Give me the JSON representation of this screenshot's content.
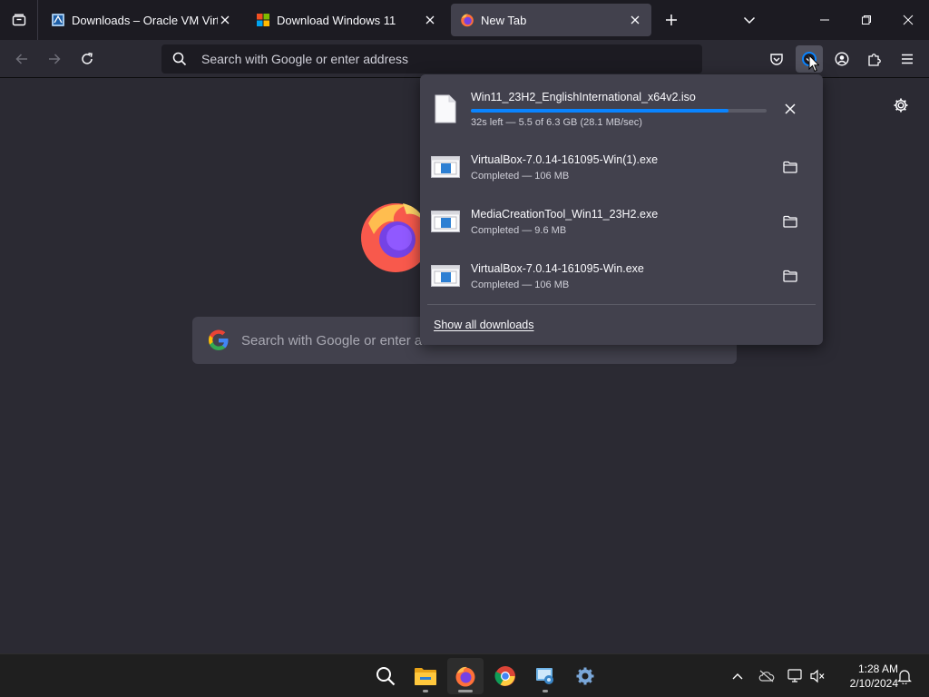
{
  "tabs": [
    {
      "title": "Downloads – Oracle VM VirtualBox",
      "favicon": "virtualbox-icon",
      "active": false
    },
    {
      "title": "Download Windows 11",
      "favicon": "windows-icon",
      "active": false
    },
    {
      "title": "New Tab",
      "favicon": "firefox-icon",
      "active": true
    }
  ],
  "urlbar": {
    "placeholder": "Search with Google or enter address"
  },
  "page": {
    "search_placeholder": "Search with Google or enter address"
  },
  "downloads": {
    "items": [
      {
        "name": "Win11_23H2_EnglishInternational_x64v2.iso",
        "status": "32s left — 5.5 of 6.3 GB (28.1 MB/sec)",
        "progress": 0.87,
        "icon": "file-icon",
        "action": "cancel-icon"
      },
      {
        "name": "VirtualBox-7.0.14-161095-Win(1).exe",
        "status": "Completed — 106 MB",
        "icon": "exe-icon",
        "action": "folder-icon"
      },
      {
        "name": "MediaCreationTool_Win11_23H2.exe",
        "status": "Completed — 9.6 MB",
        "icon": "exe-icon",
        "action": "folder-icon"
      },
      {
        "name": "VirtualBox-7.0.14-161095-Win.exe",
        "status": "Completed — 106 MB",
        "icon": "exe-icon",
        "action": "folder-icon"
      }
    ],
    "show_all": "Show all downloads"
  },
  "taskbar": {
    "apps": [
      "search-icon",
      "file-explorer-icon",
      "firefox-icon",
      "chrome-icon",
      "control-panel-icon",
      "settings-icon"
    ],
    "clock": {
      "time": "1:28 AM",
      "date": "2/10/2024"
    }
  },
  "colors": {
    "accent": "#0a84ff",
    "toolbar": "#2b2a33",
    "tabstrip": "#1c1b22",
    "panel": "#42414d"
  }
}
